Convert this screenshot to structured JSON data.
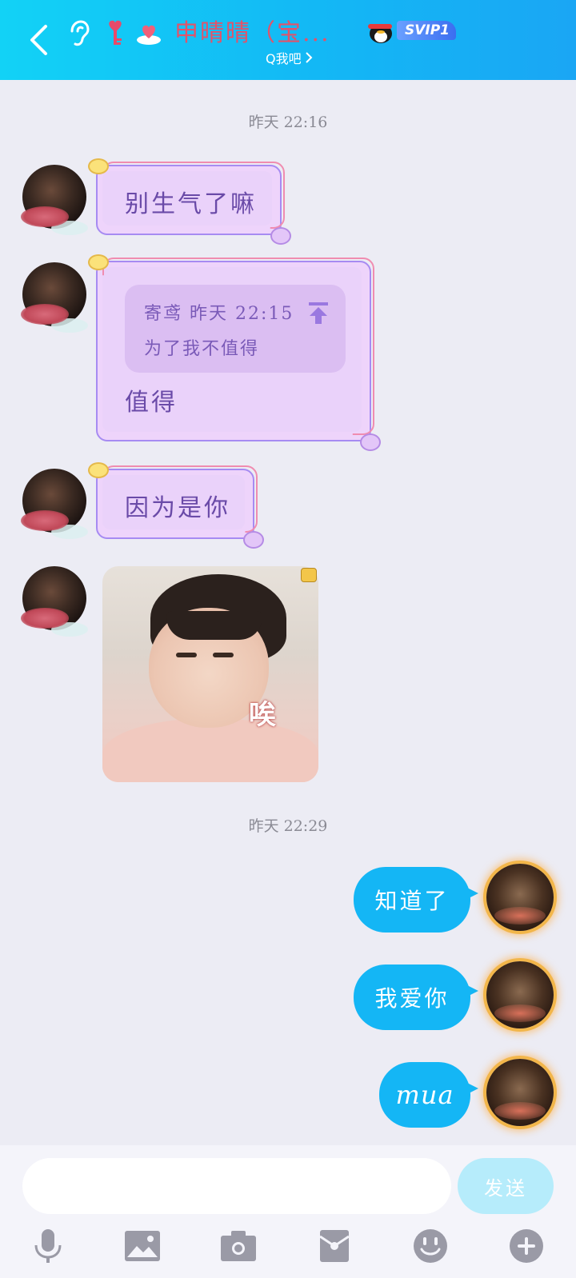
{
  "header": {
    "title": "申晴晴（宝...",
    "subtitle": "Q我吧",
    "svip_badge": "SVIP1"
  },
  "chat": {
    "timestamp_1": "昨天 22:16",
    "timestamp_2": "昨天 22:29",
    "messages": [
      {
        "side": "left",
        "type": "text",
        "text": "别生气了嘛"
      },
      {
        "side": "left",
        "type": "reply",
        "quote_meta": "寄鸢 昨天 22:15",
        "quote_text": "为了我不值得",
        "text": "值得"
      },
      {
        "side": "left",
        "type": "text",
        "text": "因为是你"
      },
      {
        "side": "left",
        "type": "sticker",
        "caption": "唉"
      },
      {
        "side": "right",
        "type": "text",
        "text": "知道了"
      },
      {
        "side": "right",
        "type": "text",
        "text": "我爱你"
      },
      {
        "side": "right",
        "type": "text",
        "text": "mua"
      }
    ]
  },
  "composer": {
    "input_value": "",
    "send_label": "发送"
  },
  "toolbar": {
    "icons": [
      "microphone-icon",
      "image-icon",
      "camera-icon",
      "red-packet-icon",
      "emoji-icon",
      "plus-icon"
    ]
  },
  "colors": {
    "header_start": "#12d2f6",
    "header_end": "#1aa6f4",
    "title_color": "#e2536a",
    "purple_bubble": "#eed4fb",
    "blue_bubble": "#14b6f5",
    "send_button": "#b6ecfb",
    "background": "#ececf4"
  }
}
